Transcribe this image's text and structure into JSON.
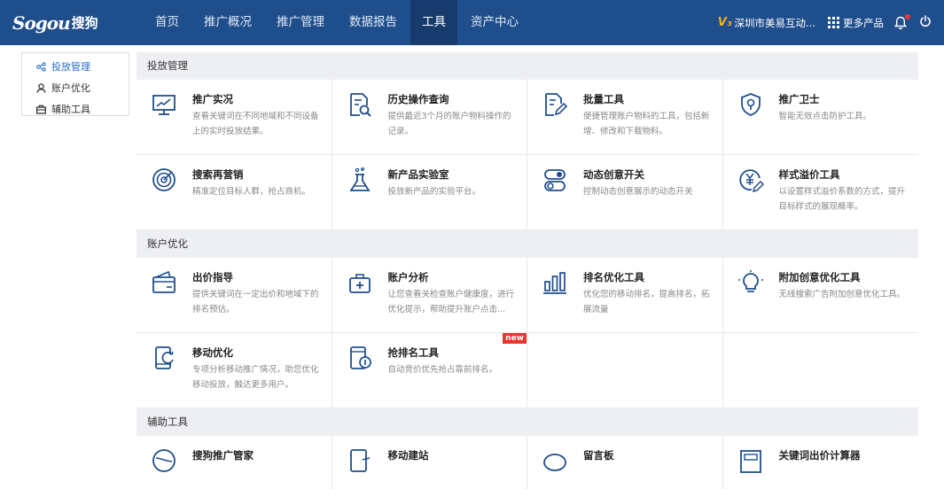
{
  "brand": {
    "logo_en": "Sogou",
    "logo_cn": "搜狗"
  },
  "nav": {
    "items": [
      {
        "label": "首页"
      },
      {
        "label": "推广概况"
      },
      {
        "label": "推广管理"
      },
      {
        "label": "数据报告"
      },
      {
        "label": "工具",
        "active": true
      },
      {
        "label": "资产中心"
      }
    ],
    "account_mark": "V₃",
    "account": "深圳市美易互动...",
    "more_products": "更多产品"
  },
  "sidebar": {
    "items": [
      {
        "label": "投放管理",
        "active": true,
        "icon": "nodes-icon"
      },
      {
        "label": "账户优化",
        "icon": "user-icon"
      },
      {
        "label": "辅助工具",
        "icon": "toolbox-icon"
      }
    ]
  },
  "sections": [
    {
      "title": "投放管理",
      "cards": [
        {
          "title": "推广实况",
          "desc": "查看关键词在不同地域和不同设备上的实时投放结果。",
          "icon": "monitor-chart-icon"
        },
        {
          "title": "历史操作查询",
          "desc": "提供最近3个月的账户物料操作的记录。",
          "icon": "document-search-icon"
        },
        {
          "title": "批量工具",
          "desc": "便捷管理账户物料的工具，包括新增、修改和下载物料。",
          "icon": "document-edit-icon"
        },
        {
          "title": "推广卫士",
          "desc": "智能无效点击防护工具。",
          "icon": "shield-icon"
        },
        {
          "title": "搜索再营销",
          "desc": "精准定位目标人群，抢占商机。",
          "icon": "target-icon"
        },
        {
          "title": "新产品实验室",
          "desc": "投放新产品的实验平台。",
          "icon": "flask-icon"
        },
        {
          "title": "动态创意开关",
          "desc": "控制动态创意展示的动态开关",
          "icon": "toggle-icon"
        },
        {
          "title": "样式溢价工具",
          "desc": "以设置样式溢价系数的方式，提升目标样式的展现概率。",
          "icon": "yen-edit-icon"
        }
      ]
    },
    {
      "title": "账户优化",
      "cards": [
        {
          "title": "出价指导",
          "desc": "提供关键词在一定出价和地域下的排名预估。",
          "icon": "wallet-icon"
        },
        {
          "title": "账户分析",
          "desc": "让您查看关检查账户健康度，进行优化提示，帮助提升账户点击...",
          "icon": "medkit-icon"
        },
        {
          "title": "排名优化工具",
          "desc": "优化您的移动排名，提高排名，拓展流量",
          "icon": "bar-chart-icon"
        },
        {
          "title": "附加创意优化工具",
          "desc": "无线搜索广告附加创意优化工具。",
          "icon": "lightbulb-icon"
        },
        {
          "title": "移动优化",
          "desc": "专项分析移动推广情况，助您优化移动投放，触达更多用户。",
          "icon": "mobile-refresh-icon"
        },
        {
          "title": "抢排名工具",
          "desc": "自动竞价优先抢占靠前排名。",
          "icon": "mobile-rank-icon",
          "badge": "new"
        },
        {
          "empty": true
        },
        {
          "empty": true
        }
      ]
    },
    {
      "title": "辅助工具",
      "cards": [
        {
          "title": "搜狗推广管家",
          "icon": "steward-icon"
        },
        {
          "title": "移动建站",
          "icon": "mobile-site-icon"
        },
        {
          "title": "留言板",
          "icon": "message-icon"
        },
        {
          "title": "关键词出价计算器",
          "icon": "calculator-icon"
        }
      ]
    }
  ],
  "colors": {
    "nav_bg": "#1f4e8c",
    "nav_active": "#173b6c",
    "accent": "#2a6bd1",
    "icon": "#1f4e8c",
    "badge": "#e8352e"
  }
}
